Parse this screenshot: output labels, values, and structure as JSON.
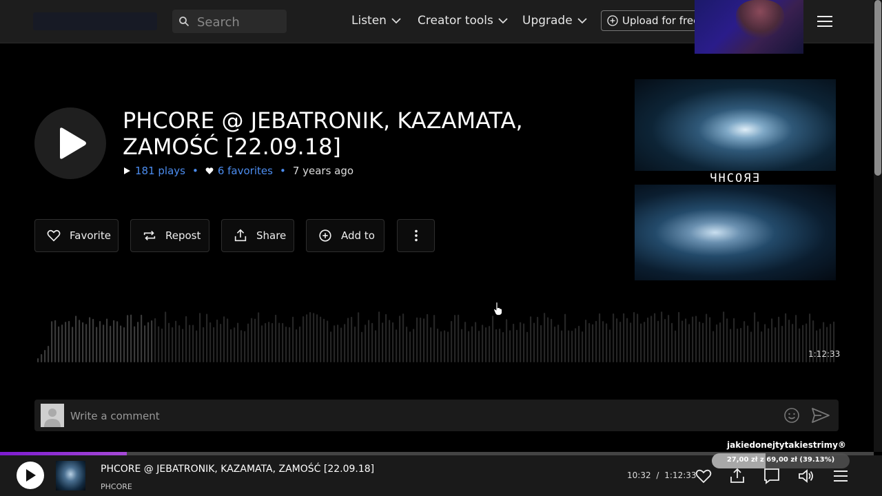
{
  "header": {
    "search_placeholder": "Search",
    "nav": {
      "listen": "Listen",
      "creator_tools": "Creator tools",
      "upgrade": "Upgrade"
    },
    "upload_label": "Upload for free"
  },
  "track": {
    "title": "PHCORE @ JEBATRONIK, KAZAMATA, ZAMOŚĆ [22.09.18]",
    "plays": "181 plays",
    "favorites": "6 favorites",
    "age": "7 years ago",
    "artwork_logo": "ЧHCOЯƎ",
    "duration": "1:12:33"
  },
  "actions": {
    "favorite": "Favorite",
    "repost": "Repost",
    "share": "Share",
    "add_to": "Add to"
  },
  "comment": {
    "placeholder": "Write a comment"
  },
  "player": {
    "title": "PHCORE @ JEBATRONIK, KAZAMATA, ZAMOŚĆ [22.09.18]",
    "artist": "PHCORE",
    "current_time": "10:32",
    "separator": "/",
    "total_time": "1:12:33",
    "progress_fraction": 0.145
  },
  "donation": {
    "name": "jakiedonejtytakiestrimy®",
    "goal_text": "27,00 zł z 69,00 zł (39.13%)",
    "fraction": 0.3913
  },
  "colors": {
    "accent_link": "#4c8df0",
    "progress": "#7d1bd0"
  }
}
